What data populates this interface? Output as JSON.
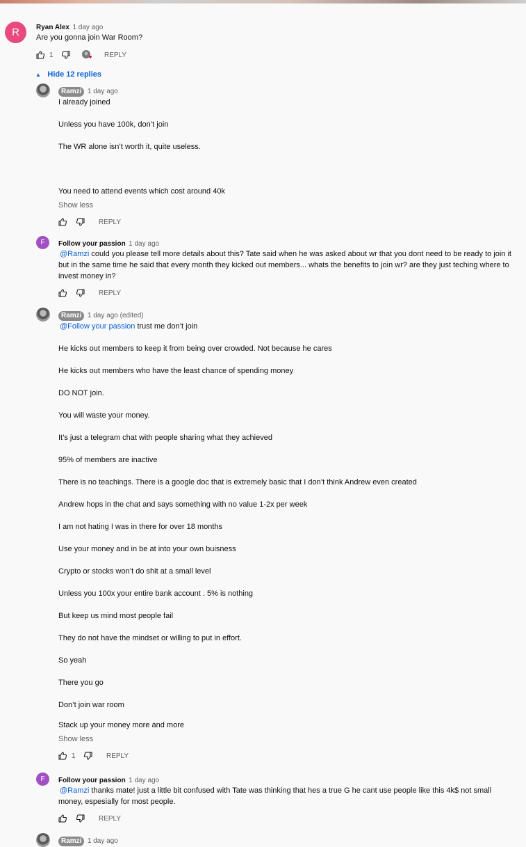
{
  "top_comment": {
    "author": "Ryan Alex",
    "time": "1 day ago",
    "text": "Are you gonna join War Room?",
    "avatar_letter": "R",
    "avatar_color": "#e84a7d",
    "likes": "1",
    "reply_label": "REPLY",
    "hide_replies_label": "Hide 12 replies"
  },
  "replies": [
    {
      "author": "Ramzi",
      "time": "1 day ago",
      "lines": [
        "I already joined",
        "Unless you have 100k, don’t join",
        "The WR alone isn’t worth it, quite useless.",
        "You need to attend events which cost around 40k"
      ],
      "show_less": "Show less",
      "reply_label": "REPLY"
    },
    {
      "author": "Follow your passion",
      "time": "1 day ago",
      "avatar_letter": "F",
      "avatar_color": "#a24fc4",
      "mention": "@Ramzi",
      "lines": [
        "could you please tell more details about this? Tate said when he was asked about wr that you dont need to be ready to join it",
        "but in the same time he said that every month they kicked out members... whats the benefits to join wr?  are they just teching where to",
        "invest money in?"
      ],
      "reply_label": "REPLY"
    },
    {
      "author": "Ramzi",
      "time": "1 day ago (edited)",
      "mention": "@Follow your passion",
      "first_line": "trust me don’t join",
      "lines": [
        "He kicks out members to keep it from being over crowded. Not because he cares",
        "He kicks out members who have the least chance of spending money",
        "DO NOT join.",
        "You will waste your money.",
        "It’s just a telegram chat with people sharing what they achieved",
        "95% of members are inactive",
        "There is no teachings. There is a google doc that is extremely basic that I don’t think Andrew even created",
        "Andrew hops in the chat and says something with no value 1-2x per week",
        "I am not hating I was in there for over 18 months",
        "Use your money and in be at into your own buisness",
        "Crypto or stocks won’t do shit at a small level",
        "Unless you 100x your entire bank account . 5% is nothing",
        "But keep us mind most people fail",
        "They do not have the mindset or willing to put in effort.",
        "So yeah",
        "There you go",
        "Don’t join war room",
        "Stack up your money more and more"
      ],
      "show_less": "Show less",
      "likes": "1",
      "reply_label": "REPLY"
    },
    {
      "author": "Follow your passion",
      "time": "1 day ago",
      "avatar_letter": "F",
      "avatar_color": "#a24fc4",
      "mention": "@Ramzi",
      "lines": [
        "thanks mate! just a little bit confused with Tate was thinking that hes a true G he  cant use people like this 4k$ not small",
        "money, espesially for most people."
      ],
      "reply_label": "REPLY"
    },
    {
      "author": "Ramzi",
      "time": "1 day ago"
    }
  ]
}
